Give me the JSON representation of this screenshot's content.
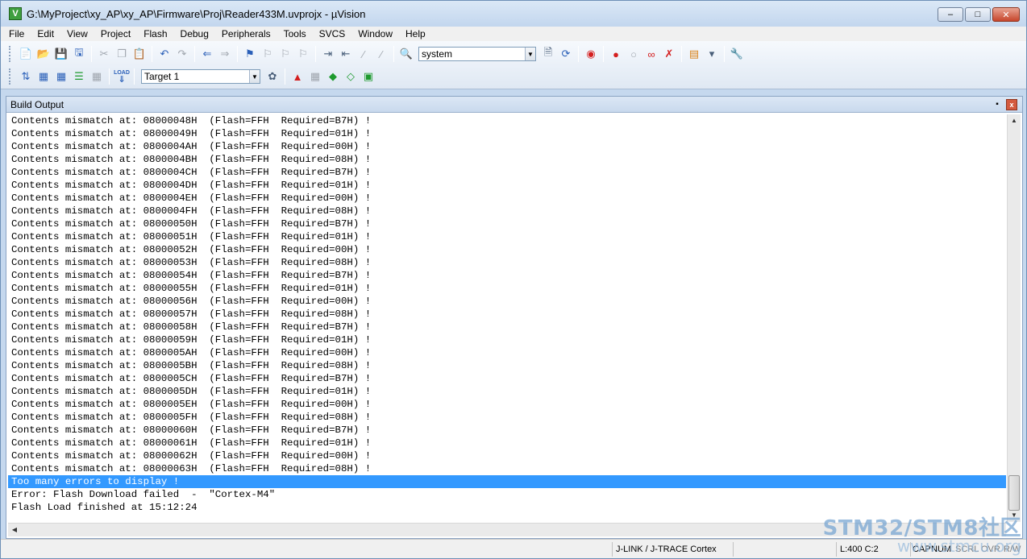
{
  "window": {
    "title": "G:\\MyProject\\xy_AP\\xy_AP\\Firmware\\Proj\\Reader433M.uvprojx - µVision",
    "app_icon_letter": "V",
    "minimize": "–",
    "maximize": "□",
    "close": "✕"
  },
  "menu": [
    "File",
    "Edit",
    "View",
    "Project",
    "Flash",
    "Debug",
    "Peripherals",
    "Tools",
    "SVCS",
    "Window",
    "Help"
  ],
  "toolbar": {
    "find_combo_value": "system",
    "target_combo_value": "Target 1",
    "load_icon_text": "LOAD"
  },
  "panel": {
    "title": "Build Output",
    "pin_label": "▪",
    "close_label": "x"
  },
  "output_lines": [
    "Contents mismatch at: 08000048H  (Flash=FFH  Required=B7H) !",
    "Contents mismatch at: 08000049H  (Flash=FFH  Required=01H) !",
    "Contents mismatch at: 0800004AH  (Flash=FFH  Required=00H) !",
    "Contents mismatch at: 0800004BH  (Flash=FFH  Required=08H) !",
    "Contents mismatch at: 0800004CH  (Flash=FFH  Required=B7H) !",
    "Contents mismatch at: 0800004DH  (Flash=FFH  Required=01H) !",
    "Contents mismatch at: 0800004EH  (Flash=FFH  Required=00H) !",
    "Contents mismatch at: 0800004FH  (Flash=FFH  Required=08H) !",
    "Contents mismatch at: 08000050H  (Flash=FFH  Required=B7H) !",
    "Contents mismatch at: 08000051H  (Flash=FFH  Required=01H) !",
    "Contents mismatch at: 08000052H  (Flash=FFH  Required=00H) !",
    "Contents mismatch at: 08000053H  (Flash=FFH  Required=08H) !",
    "Contents mismatch at: 08000054H  (Flash=FFH  Required=B7H) !",
    "Contents mismatch at: 08000055H  (Flash=FFH  Required=01H) !",
    "Contents mismatch at: 08000056H  (Flash=FFH  Required=00H) !",
    "Contents mismatch at: 08000057H  (Flash=FFH  Required=08H) !",
    "Contents mismatch at: 08000058H  (Flash=FFH  Required=B7H) !",
    "Contents mismatch at: 08000059H  (Flash=FFH  Required=01H) !",
    "Contents mismatch at: 0800005AH  (Flash=FFH  Required=00H) !",
    "Contents mismatch at: 0800005BH  (Flash=FFH  Required=08H) !",
    "Contents mismatch at: 0800005CH  (Flash=FFH  Required=B7H) !",
    "Contents mismatch at: 0800005DH  (Flash=FFH  Required=01H) !",
    "Contents mismatch at: 0800005EH  (Flash=FFH  Required=00H) !",
    "Contents mismatch at: 0800005FH  (Flash=FFH  Required=08H) !",
    "Contents mismatch at: 08000060H  (Flash=FFH  Required=B7H) !",
    "Contents mismatch at: 08000061H  (Flash=FFH  Required=01H) !",
    "Contents mismatch at: 08000062H  (Flash=FFH  Required=00H) !",
    "Contents mismatch at: 08000063H  (Flash=FFH  Required=08H) !",
    "Too many errors to display !",
    "Error: Flash Download failed  -  \"Cortex-M4\"",
    "Flash Load finished at 15:12:24"
  ],
  "selected_line_index": 28,
  "status": {
    "debugger": "J-LINK / J-TRACE Cortex",
    "position": "L:400 C:2",
    "cap": "CAP",
    "num": "NUM",
    "scrl": "SCRL",
    "ovr": "OVR",
    "rw": "R/W"
  },
  "watermark": {
    "line1": "STM32/STM8社区",
    "line2": "www.stmcu.org"
  },
  "colors": {
    "selection": "#3399ff",
    "titlebar": "#c2d6ee",
    "close_button": "#c7452b"
  }
}
